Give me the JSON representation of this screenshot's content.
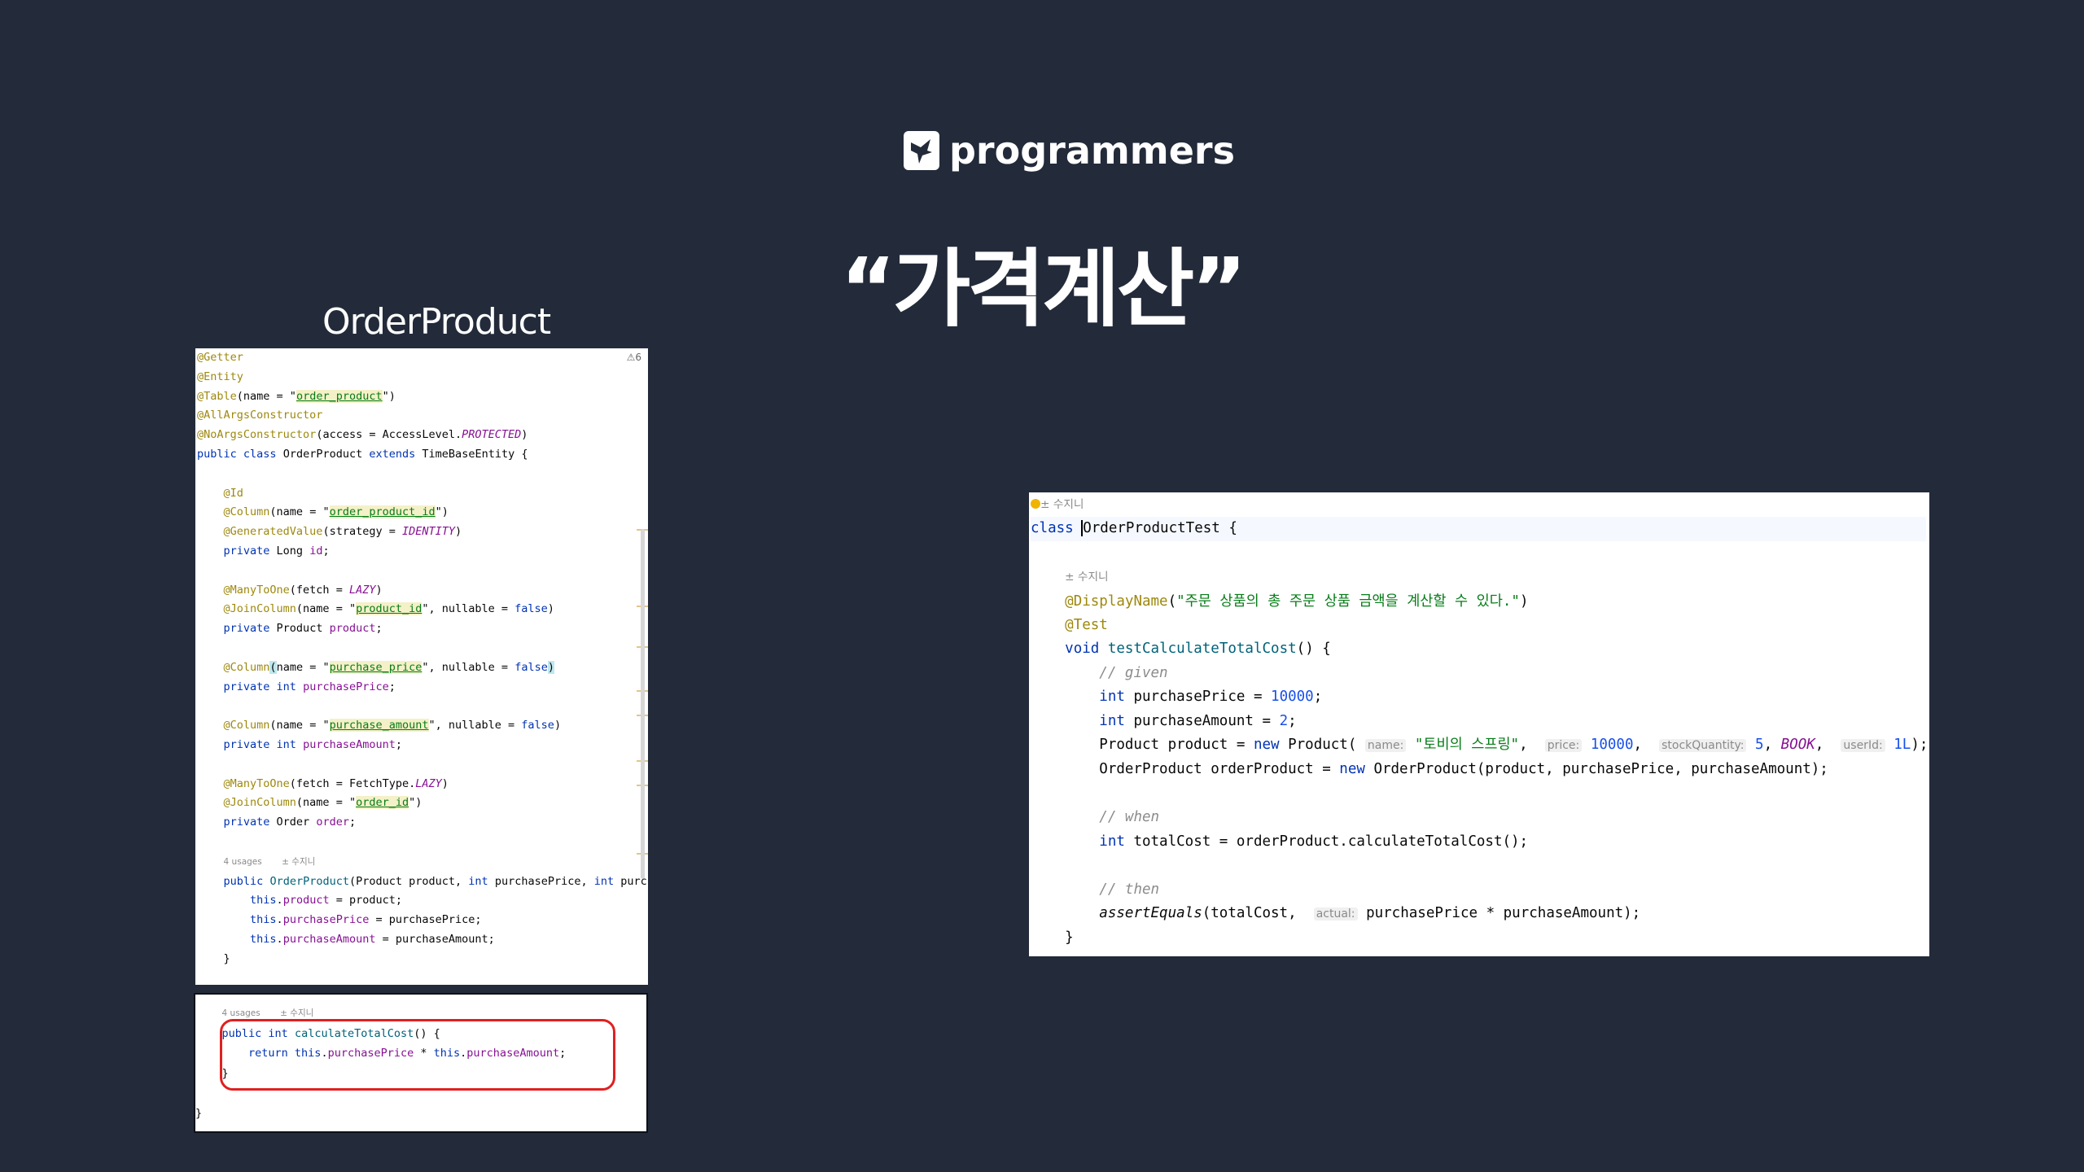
{
  "logo": {
    "icon": "programmers-bird-icon",
    "text": "programmers"
  },
  "title": "“가격계산”",
  "subtitle": "OrderProduct",
  "entity_panel": {
    "warnings": "⚠6",
    "usages": "4 usages",
    "author": "± 수지니",
    "annotations": {
      "getter": "@Getter",
      "entity": "@Entity",
      "table": "@Table",
      "all_args": "@AllArgsConstructor",
      "no_args": "@NoArgsConstructor",
      "id": "@Id",
      "column": "@Column",
      "generated": "@GeneratedValue",
      "many_to_one": "@ManyToOne",
      "join_column": "@JoinColumn"
    },
    "strings": {
      "order_product": "order_product",
      "order_product_id": "order_product_id",
      "product_id": "product_id",
      "purchase_price": "purchase_price",
      "purchase_amount": "purchase_amount",
      "order_id": "order_id"
    },
    "constants": {
      "protected": "PROTECTED",
      "identity": "IDENTITY",
      "lazy": "LAZY"
    },
    "class_name": "OrderProduct",
    "parent_class": "TimeBaseEntity"
  },
  "method_panel": {
    "usages": "4 usages",
    "author": "± 수지니",
    "method_name": "calculateTotalCost"
  },
  "test_panel": {
    "author": "± 수지니",
    "class_name": "OrderProductTest",
    "display_name": "\"주문 상품의 총 주문 상품 금액을 계산할 수 있다.\"",
    "method_name": "testCalculateTotalCost",
    "comments": {
      "given": "// given",
      "when": "// when",
      "then": "// then"
    },
    "hints": {
      "name": "name:",
      "price": "price:",
      "stock": "stockQuantity:",
      "user": "userId:",
      "actual": "actual:"
    },
    "product_name": "\"토비의 스프링\"",
    "values": {
      "price": "10000",
      "amount": "2",
      "stock": "5",
      "user_id": "1L",
      "category": "BOOK"
    }
  },
  "colors": {
    "background": "#232b3a",
    "highlight_box": "#e02020"
  }
}
